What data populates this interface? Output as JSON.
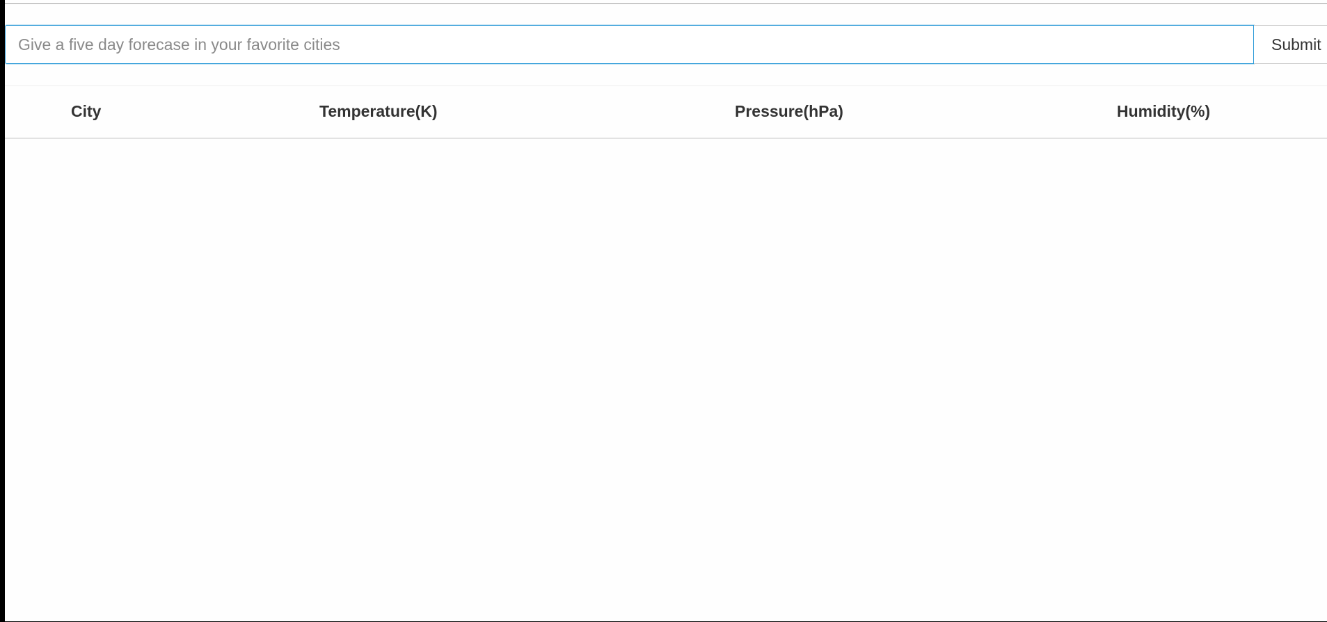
{
  "search": {
    "placeholder": "Give a five day forecase in your favorite cities",
    "value": "",
    "submit_label": "Submit"
  },
  "table": {
    "columns": [
      "City",
      "Temperature(K)",
      "Pressure(hPa)",
      "Humidity(%)"
    ],
    "rows": []
  },
  "colors": {
    "focus_border": "#2b9ad8",
    "header_text": "#333333",
    "placeholder_text": "#8a8a8a"
  }
}
